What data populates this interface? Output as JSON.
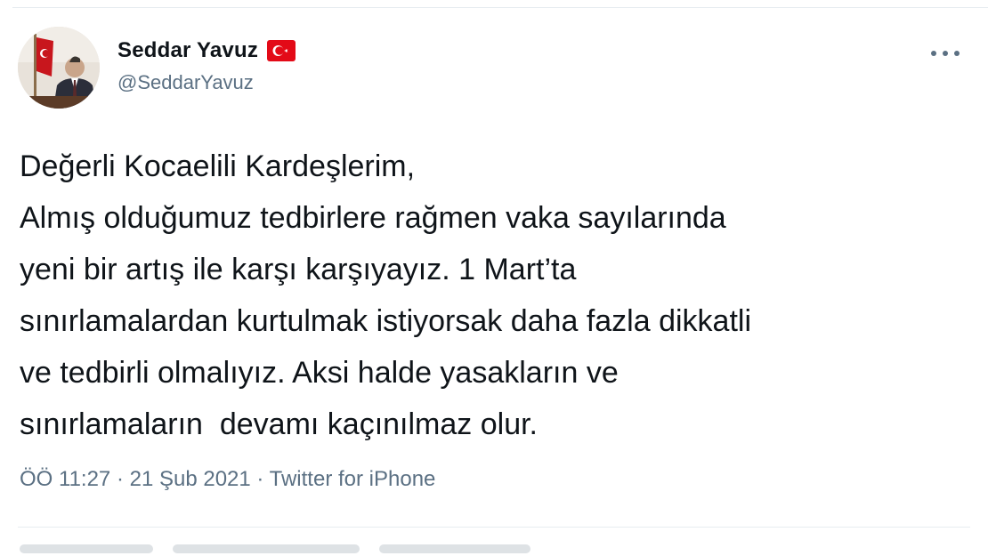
{
  "author": {
    "display_name": "Seddar Yavuz",
    "handle": "@SeddarYavuz",
    "flag_icon": "turkey-flag-icon",
    "flag_colors": {
      "red": "#e30a17",
      "white": "#ffffff"
    }
  },
  "menu": {
    "more_icon": "more-options-icon"
  },
  "tweet": {
    "lines": [
      "Değerli Kocaelili Kardeşlerim,",
      "Almış olduğumuz tedbirlere rağmen vaka sayılarında",
      "yeni bir artış ile karşı karşıyayız. 1 Mart’ta",
      "sınırlamalardan kurtulmak istiyorsak daha fazla dikkatli",
      "ve tedbirli olmalıyız. Aksi halde yasakların ve",
      "sınırlamaların  devamı kaçınılmaz olur."
    ]
  },
  "meta": {
    "time": "ÖÖ 11:27",
    "separator": " · ",
    "date": "21 Şub 2021",
    "source": "Twitter for iPhone"
  },
  "colors": {
    "text_primary": "#0f1419",
    "text_secondary": "#5b7083",
    "divider": "#e6ecf0"
  }
}
